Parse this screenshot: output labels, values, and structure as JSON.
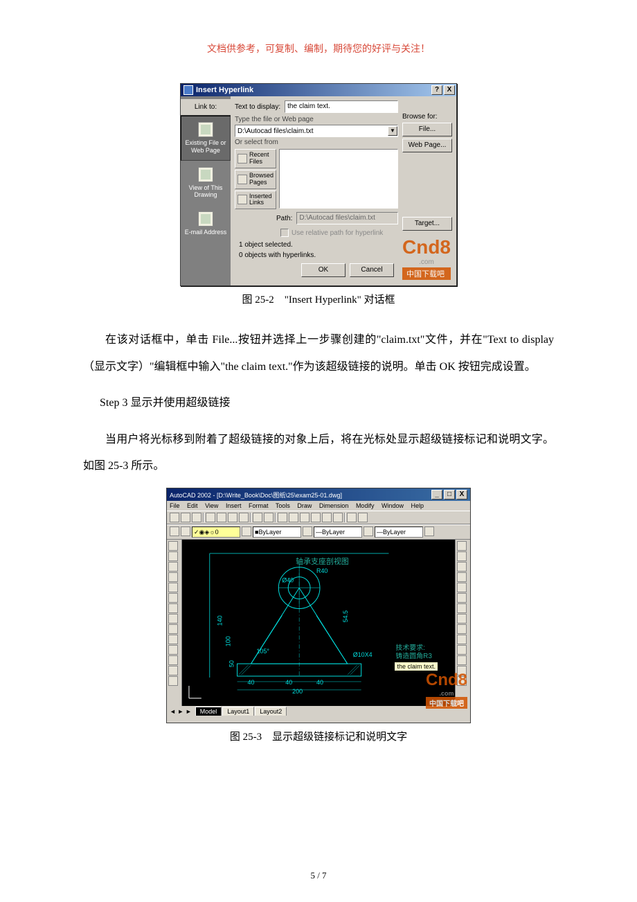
{
  "header_note": "文档供参考，可复制、编制，期待您的好评与关注！",
  "dialog": {
    "title": "Insert Hyperlink",
    "help_btn": "?",
    "close_btn": "X",
    "link_to_label": "Link to:",
    "text_to_display_label": "Text to display:",
    "text_to_display_value": "the claim text.",
    "type_label": "Type the file or Web page",
    "file_value": "D:\\Autocad files\\claim.txt",
    "select_from_label": "Or select from",
    "tabs": {
      "existing": "Existing File or\nWeb Page",
      "view": "View of This\nDrawing",
      "email": "E-mail Address"
    },
    "src_tabs": {
      "recent": "Recent\nFiles",
      "browsed": "Browsed\nPages",
      "inserted": "Inserted\nLinks"
    },
    "browse_for_label": "Browse for:",
    "file_btn": "File...",
    "web_btn": "Web Page...",
    "target_btn": "Target...",
    "path_label": "Path:",
    "path_value": "D:\\Autocad files\\claim.txt",
    "relative_chk": "Use relative path for hyperlink",
    "status1": "1 object selected.",
    "status2": "0 objects with hyperlinks.",
    "ok_btn": "OK",
    "cancel_btn": "Cancel"
  },
  "watermark": {
    "logo": "Cnd8",
    "dotcom": ".com",
    "sub": "中国下载吧"
  },
  "caption1": "图 25-2　\"Insert Hyperlink\" 对话框",
  "para1": "在该对话框中，单击 File...按钮并选择上一步骤创建的\"claim.txt\"文件，并在\"Text to display（显示文字）\"编辑框中输入\"the claim text.\"作为该超级链接的说明。单击 OK 按钮完成设置。",
  "step3": "Step 3  显示并使用超级链接",
  "para2": "当用户将光标移到附着了超级链接的对象上后，将在光标处显示超级链接标记和说明文字。如图 25-3 所示。",
  "cad": {
    "title": "AutoCAD 2002 - [D:\\Write_Book\\Doc\\图纸\\25\\exam25-01.dwg]",
    "menu": [
      "File",
      "Edit",
      "View",
      "Insert",
      "Format",
      "Tools",
      "Draw",
      "Dimension",
      "Modify",
      "Window",
      "Help"
    ],
    "layer_combo": "0",
    "bylayer": "ByLayer",
    "drawing_title": "轴承支座剖视图",
    "dims": {
      "r40": "R40",
      "d40": "Ø40",
      "h140": "140",
      "h100": "100",
      "h50": "50",
      "a105": "105°",
      "w40l": "40",
      "w40r": "40",
      "w40m": "40",
      "w200": "200",
      "d10x4": "Ø10X4",
      "s54": "54.5"
    },
    "tooltip_label": "技术要求:",
    "tooltip_line": "铸造圆角R3",
    "tooltip_yellow": "the claim text.",
    "tab_model": "Model",
    "tab_l1": "Layout1",
    "tab_l2": "Layout2"
  },
  "caption2": "图 25-3　显示超级链接标记和说明文字",
  "page_num": "5 / 7"
}
